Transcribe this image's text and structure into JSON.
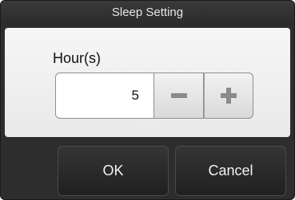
{
  "dialog": {
    "title": "Sleep Setting",
    "hour_label": "Hour(s)",
    "hour_value": "5",
    "minus_icon": "minus-icon",
    "plus_icon": "plus-icon",
    "ok_label": "OK",
    "cancel_label": "Cancel"
  },
  "colors": {
    "dialog_background": "#2d2d2d",
    "panel_background": "#f0f0f0",
    "icon_gray": "#8a8a8a",
    "button_text": "#f2f2f2"
  }
}
